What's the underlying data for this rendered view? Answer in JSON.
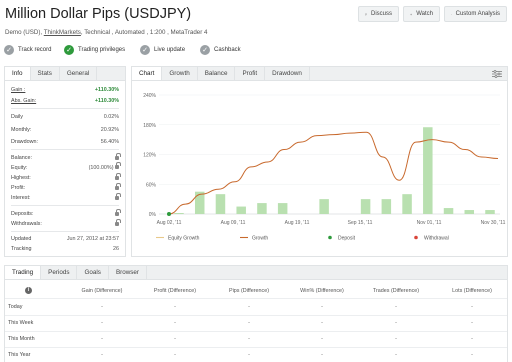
{
  "header": {
    "title": "Million Dollar Pips (USDJPY)",
    "subtitle_pre": "Demo (USD), ",
    "subtitle_link": "ThinkMarkets",
    "subtitle_post": ", Technical , Automated , 1:200 , MetaTrader 4",
    "buttons": {
      "discuss": "Discuss",
      "watch": "Watch",
      "custom_analysis": "Custom Analysis"
    }
  },
  "privileges": [
    {
      "label": "Track record",
      "status": "gray"
    },
    {
      "label": "Trading privileges",
      "status": "green"
    },
    {
      "label": "Live update",
      "status": "gray"
    },
    {
      "label": "Cashback",
      "status": "gray"
    }
  ],
  "left_tabs": [
    "Info",
    "Stats",
    "General"
  ],
  "info": {
    "gain_label": "Gain :",
    "gain_value": "+110.30%",
    "abs_gain_label": "Abs. Gain:",
    "abs_gain_value": "+110.30%",
    "daily_label": "Daily",
    "daily_value": "0.02%",
    "monthly_label": "Monthly:",
    "monthly_value": "20.92%",
    "drawdown_label": "Drawdown:",
    "drawdown_value": "56.40%",
    "balance_label": "Balance:",
    "equity_label": "Equity:",
    "equity_value": "(100.00%)",
    "highest_label": "Highest:",
    "profit_label": "Profit:",
    "interest_label": "Interest:",
    "deposits_label": "Deposits:",
    "withdrawals_label": "Withdrawals:",
    "updated_label": "Updated",
    "updated_value": "Jun 27, 2012 at 23:57",
    "tracking_label": "Tracking",
    "tracking_value": "26"
  },
  "chart_tabs": [
    "Chart",
    "Growth",
    "Balance",
    "Profit",
    "Drawdown"
  ],
  "chart_data": {
    "type": "bar",
    "y_ticks": [
      "240%",
      "180%",
      "120%",
      "60%",
      "0%"
    ],
    "x_ticks": [
      "Aug 02, '11",
      "Aug 09, '11",
      "Aug 19, '11",
      "Sep 15, '11",
      "Nov 01, '11",
      "Nov 30, '11"
    ],
    "ylim": [
      0,
      240
    ],
    "bars": [
      2,
      45,
      40,
      15,
      22,
      22,
      0,
      30,
      0,
      30,
      30,
      40,
      175,
      12,
      8,
      8
    ],
    "line": [
      0,
      20,
      40,
      50,
      65,
      95,
      105,
      130,
      145,
      158,
      160,
      163,
      165,
      115,
      68,
      145,
      150,
      145,
      130,
      115,
      112
    ],
    "legend": [
      "Equity Growth",
      "Growth",
      "Deposit",
      "Withdrawal"
    ],
    "colors": {
      "bar": "#b9e0b0",
      "line": "#c8692d",
      "deposit": "#2e9a3c",
      "withdrawal": "#d9453a",
      "equity": "#e8c98a"
    }
  },
  "table": {
    "tabs": [
      "Trading",
      "Periods",
      "Goals",
      "Browser"
    ],
    "columns": [
      "Gain (Difference)",
      "Profit (Difference)",
      "Pips (Difference)",
      "Win% (Difference)",
      "Trades (Difference)",
      "Lots (Difference)"
    ],
    "rows": [
      "Today",
      "This Week",
      "This Month",
      "This Year"
    ],
    "cell": "-"
  }
}
